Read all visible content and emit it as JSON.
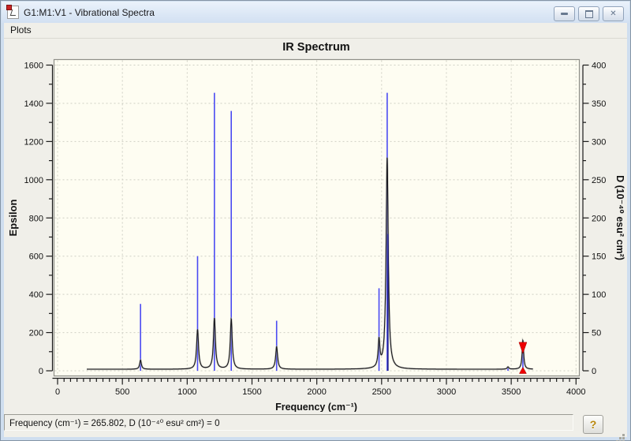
{
  "window": {
    "title": "G1:M1:V1 - Vibrational Spectra",
    "controls": {
      "close_glyph": "✕"
    }
  },
  "menu": {
    "plots_label": "Plots"
  },
  "chart_data": {
    "type": "line",
    "title": "IR Spectrum",
    "xlabel": "Frequency (cm⁻¹)",
    "ylabel_left": "Epsilon",
    "ylabel_right": "D (10⁻⁴⁰ esu² cm²)",
    "xlim": [
      0,
      4000
    ],
    "ylim_left": [
      0,
      1600
    ],
    "ylim_right": [
      0,
      400
    ],
    "x_ticks": [
      0,
      500,
      1000,
      1500,
      2000,
      2500,
      3000,
      3500,
      4000
    ],
    "x_minor_step": 50,
    "left_ticks": [
      0,
      200,
      400,
      600,
      800,
      1000,
      1200,
      1400,
      1600
    ],
    "left_minor_step": 100,
    "right_ticks": [
      0,
      50,
      100,
      150,
      200,
      250,
      300,
      350,
      400
    ],
    "right_minor_step": 25,
    "grid": "dashed",
    "sticks": [
      {
        "freq": 640,
        "epsilon": 350
      },
      {
        "freq": 1080,
        "epsilon": 600
      },
      {
        "freq": 1210,
        "epsilon": 1455
      },
      {
        "freq": 1340,
        "epsilon": 1360
      },
      {
        "freq": 1690,
        "epsilon": 262
      },
      {
        "freq": 2480,
        "epsilon": 432
      },
      {
        "freq": 2543,
        "epsilon": 1455
      },
      {
        "freq": 3475,
        "epsilon": 14
      },
      {
        "freq": 3590,
        "epsilon": 110
      }
    ],
    "sticks_secondary": [
      {
        "freq": 2549,
        "epsilon": 716
      }
    ],
    "curve": {
      "baseline_epsilon": 8,
      "range": [
        225,
        3668
      ],
      "peaks": [
        {
          "freq": 640,
          "epsilon": 48,
          "gamma": 8
        },
        {
          "freq": 1080,
          "epsilon": 207,
          "gamma": 9
        },
        {
          "freq": 1210,
          "epsilon": 267,
          "gamma": 9
        },
        {
          "freq": 1340,
          "epsilon": 262,
          "gamma": 9
        },
        {
          "freq": 1690,
          "epsilon": 118,
          "gamma": 9
        },
        {
          "freq": 2480,
          "epsilon": 140,
          "gamma": 8
        },
        {
          "freq": 2543,
          "epsilon": 1108,
          "gamma": 10
        },
        {
          "freq": 3475,
          "epsilon": 12,
          "gamma": 8
        },
        {
          "freq": 3590,
          "epsilon": 152,
          "gamma": 7
        }
      ]
    },
    "selection_marker": {
      "freq": 3590,
      "arrow_top_epsilon": 149,
      "arrow_tip_epsilon": 91
    },
    "colors": {
      "plot_bg": "#fefdf2",
      "frame": "#8f8f88",
      "grid": "#cfcfc4",
      "axis": "#1a1a1a",
      "stick": "#4a4af2",
      "stick_secondary": "#232388",
      "curve": "#17171c",
      "curve_halo": "#b3b3ab",
      "marker": "#ee0000",
      "text": "#111111"
    }
  },
  "status_bar": {
    "text": "Frequency (cm⁻¹) = 265.802, D (10⁻⁴⁰ esu² cm²) = 0",
    "help_glyph": "?"
  }
}
